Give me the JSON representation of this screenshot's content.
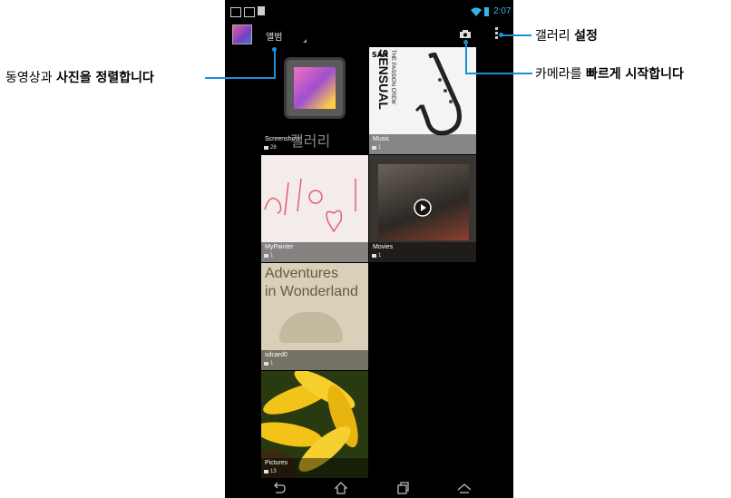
{
  "status_bar": {
    "time": "2:07"
  },
  "action_bar": {
    "album_label": "앨범"
  },
  "gallery_placeholder_label": "갤러리",
  "albums": [
    {
      "name": "Screenshots",
      "count": "28"
    },
    {
      "name": "Music",
      "count": "1",
      "cover_text": [
        "SAX",
        "SENSUAL",
        "THE PASSION CREW"
      ]
    },
    {
      "name": "MyPainter",
      "count": "1"
    },
    {
      "name": "Movies",
      "count": "1"
    },
    {
      "name": "sdcard0",
      "count": "1",
      "cover_text": [
        "Adventures",
        "in Wonderland"
      ]
    },
    {
      "name": "Pictures",
      "count": "13"
    }
  ],
  "annotations": {
    "left": {
      "normal": "동영상과 ",
      "bold": "사진을 정렬합니다"
    },
    "settings": {
      "normal": "갤러리 ",
      "bold": "설정"
    },
    "camera": {
      "normal": "카메라를 ",
      "bold": "빠르게 시작합니다"
    }
  },
  "colors": {
    "accent": "#33b5e5",
    "callout_line": "#1a8fd8"
  }
}
